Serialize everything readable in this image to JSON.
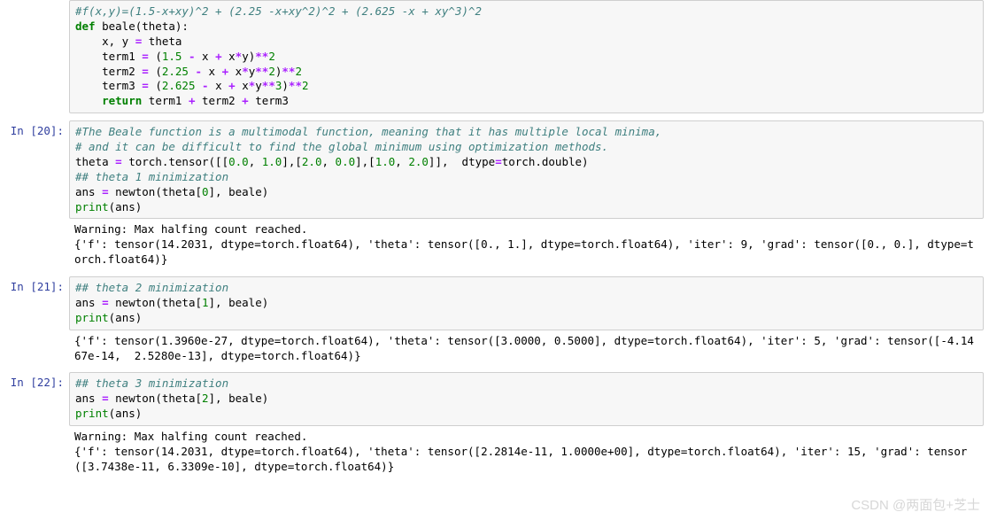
{
  "cells": [
    {
      "prompt": "",
      "frag": "c0",
      "output": null
    },
    {
      "prompt": "In  [20]:",
      "frag": "c1",
      "output": "Warning: Max halfing count reached.\n{'f': tensor(14.2031, dtype=torch.float64), 'theta': tensor([0., 1.], dtype=torch.float64), 'iter': 9, 'grad': tensor([0., 0.], dtype=torch.float64)}"
    },
    {
      "prompt": "In  [21]:",
      "frag": "c2",
      "output": "{'f': tensor(1.3960e-27, dtype=torch.float64), 'theta': tensor([3.0000, 0.5000], dtype=torch.float64), 'iter': 5, 'grad': tensor([-4.1467e-14,  2.5280e-13], dtype=torch.float64)}"
    },
    {
      "prompt": "In  [22]:",
      "frag": "c3",
      "output": "Warning: Max halfing count reached.\n{'f': tensor(14.2031, dtype=torch.float64), 'theta': tensor([2.2814e-11, 1.0000e+00], dtype=torch.float64), 'iter': 15, 'grad': tensor([3.7438e-11, 6.3309e-10], dtype=torch.float64)}"
    }
  ],
  "code_fragments": {
    "c0": [
      {
        "cls": "tok-comment",
        "t": "#f(x,y)=(1.5-x+xy)^2 + (2.25 -x+xy^2)^2 + (2.625 -x + xy^3)^2"
      },
      {
        "t": "\n"
      },
      {
        "cls": "tok-kw",
        "t": "def"
      },
      {
        "t": " beale(theta):\n"
      },
      {
        "t": "    x, y "
      },
      {
        "cls": "tok-op",
        "t": "="
      },
      {
        "t": " theta\n"
      },
      {
        "t": "    term1 "
      },
      {
        "cls": "tok-op",
        "t": "="
      },
      {
        "t": " ("
      },
      {
        "cls": "tok-num",
        "t": "1.5"
      },
      {
        "t": " "
      },
      {
        "cls": "tok-op",
        "t": "-"
      },
      {
        "t": " x "
      },
      {
        "cls": "tok-op",
        "t": "+"
      },
      {
        "t": " x"
      },
      {
        "cls": "tok-op",
        "t": "*"
      },
      {
        "t": "y)"
      },
      {
        "cls": "tok-op",
        "t": "**"
      },
      {
        "cls": "tok-num",
        "t": "2"
      },
      {
        "t": "\n"
      },
      {
        "t": "    term2 "
      },
      {
        "cls": "tok-op",
        "t": "="
      },
      {
        "t": " ("
      },
      {
        "cls": "tok-num",
        "t": "2.25"
      },
      {
        "t": " "
      },
      {
        "cls": "tok-op",
        "t": "-"
      },
      {
        "t": " x "
      },
      {
        "cls": "tok-op",
        "t": "+"
      },
      {
        "t": " x"
      },
      {
        "cls": "tok-op",
        "t": "*"
      },
      {
        "t": "y"
      },
      {
        "cls": "tok-op",
        "t": "**"
      },
      {
        "cls": "tok-num",
        "t": "2"
      },
      {
        "t": ")"
      },
      {
        "cls": "tok-op",
        "t": "**"
      },
      {
        "cls": "tok-num",
        "t": "2"
      },
      {
        "t": "\n"
      },
      {
        "t": "    term3 "
      },
      {
        "cls": "tok-op",
        "t": "="
      },
      {
        "t": " ("
      },
      {
        "cls": "tok-num",
        "t": "2.625"
      },
      {
        "t": " "
      },
      {
        "cls": "tok-op",
        "t": "-"
      },
      {
        "t": " x "
      },
      {
        "cls": "tok-op",
        "t": "+"
      },
      {
        "t": " x"
      },
      {
        "cls": "tok-op",
        "t": "*"
      },
      {
        "t": "y"
      },
      {
        "cls": "tok-op",
        "t": "**"
      },
      {
        "cls": "tok-num",
        "t": "3"
      },
      {
        "t": ")"
      },
      {
        "cls": "tok-op",
        "t": "**"
      },
      {
        "cls": "tok-num",
        "t": "2"
      },
      {
        "t": "\n"
      },
      {
        "t": "    "
      },
      {
        "cls": "tok-kw",
        "t": "return"
      },
      {
        "t": " term1 "
      },
      {
        "cls": "tok-op",
        "t": "+"
      },
      {
        "t": " term2 "
      },
      {
        "cls": "tok-op",
        "t": "+"
      },
      {
        "t": " term3"
      }
    ],
    "c1": [
      {
        "cls": "tok-comment",
        "t": "#The Beale function is a multimodal function, meaning that it has multiple local minima,"
      },
      {
        "t": "\n"
      },
      {
        "cls": "tok-comment",
        "t": "# and it can be difficult to find the global minimum using optimization methods."
      },
      {
        "t": "\n"
      },
      {
        "t": "theta "
      },
      {
        "cls": "tok-op",
        "t": "="
      },
      {
        "t": " torch.tensor([["
      },
      {
        "cls": "tok-num",
        "t": "0.0"
      },
      {
        "t": ", "
      },
      {
        "cls": "tok-num",
        "t": "1.0"
      },
      {
        "t": "],["
      },
      {
        "cls": "tok-num",
        "t": "2.0"
      },
      {
        "t": ", "
      },
      {
        "cls": "tok-num",
        "t": "0.0"
      },
      {
        "t": "],["
      },
      {
        "cls": "tok-num",
        "t": "1.0"
      },
      {
        "t": ", "
      },
      {
        "cls": "tok-num",
        "t": "2.0"
      },
      {
        "t": "]],  dtype"
      },
      {
        "cls": "tok-op",
        "t": "="
      },
      {
        "t": "torch.double)\n"
      },
      {
        "cls": "tok-comment",
        "t": "## theta 1 minimization"
      },
      {
        "t": "\n"
      },
      {
        "t": "ans "
      },
      {
        "cls": "tok-op",
        "t": "="
      },
      {
        "t": " newton(theta["
      },
      {
        "cls": "tok-num",
        "t": "0"
      },
      {
        "t": "], beale)\n"
      },
      {
        "cls": "tok-bi",
        "t": "print"
      },
      {
        "t": "(ans)"
      }
    ],
    "c2": [
      {
        "cls": "tok-comment",
        "t": "## theta 2 minimization"
      },
      {
        "t": "\n"
      },
      {
        "t": "ans "
      },
      {
        "cls": "tok-op",
        "t": "="
      },
      {
        "t": " newton(theta["
      },
      {
        "cls": "tok-num",
        "t": "1"
      },
      {
        "t": "], beale)\n"
      },
      {
        "cls": "tok-bi",
        "t": "print"
      },
      {
        "t": "(ans)"
      }
    ],
    "c3": [
      {
        "cls": "tok-comment",
        "t": "## theta 3 minimization"
      },
      {
        "t": "\n"
      },
      {
        "t": "ans "
      },
      {
        "cls": "tok-op",
        "t": "="
      },
      {
        "t": " newton(theta["
      },
      {
        "cls": "tok-num",
        "t": "2"
      },
      {
        "t": "], beale)\n"
      },
      {
        "cls": "tok-bi",
        "t": "print"
      },
      {
        "t": "(ans)"
      }
    ]
  },
  "watermark": "CSDN @两面包+芝士"
}
